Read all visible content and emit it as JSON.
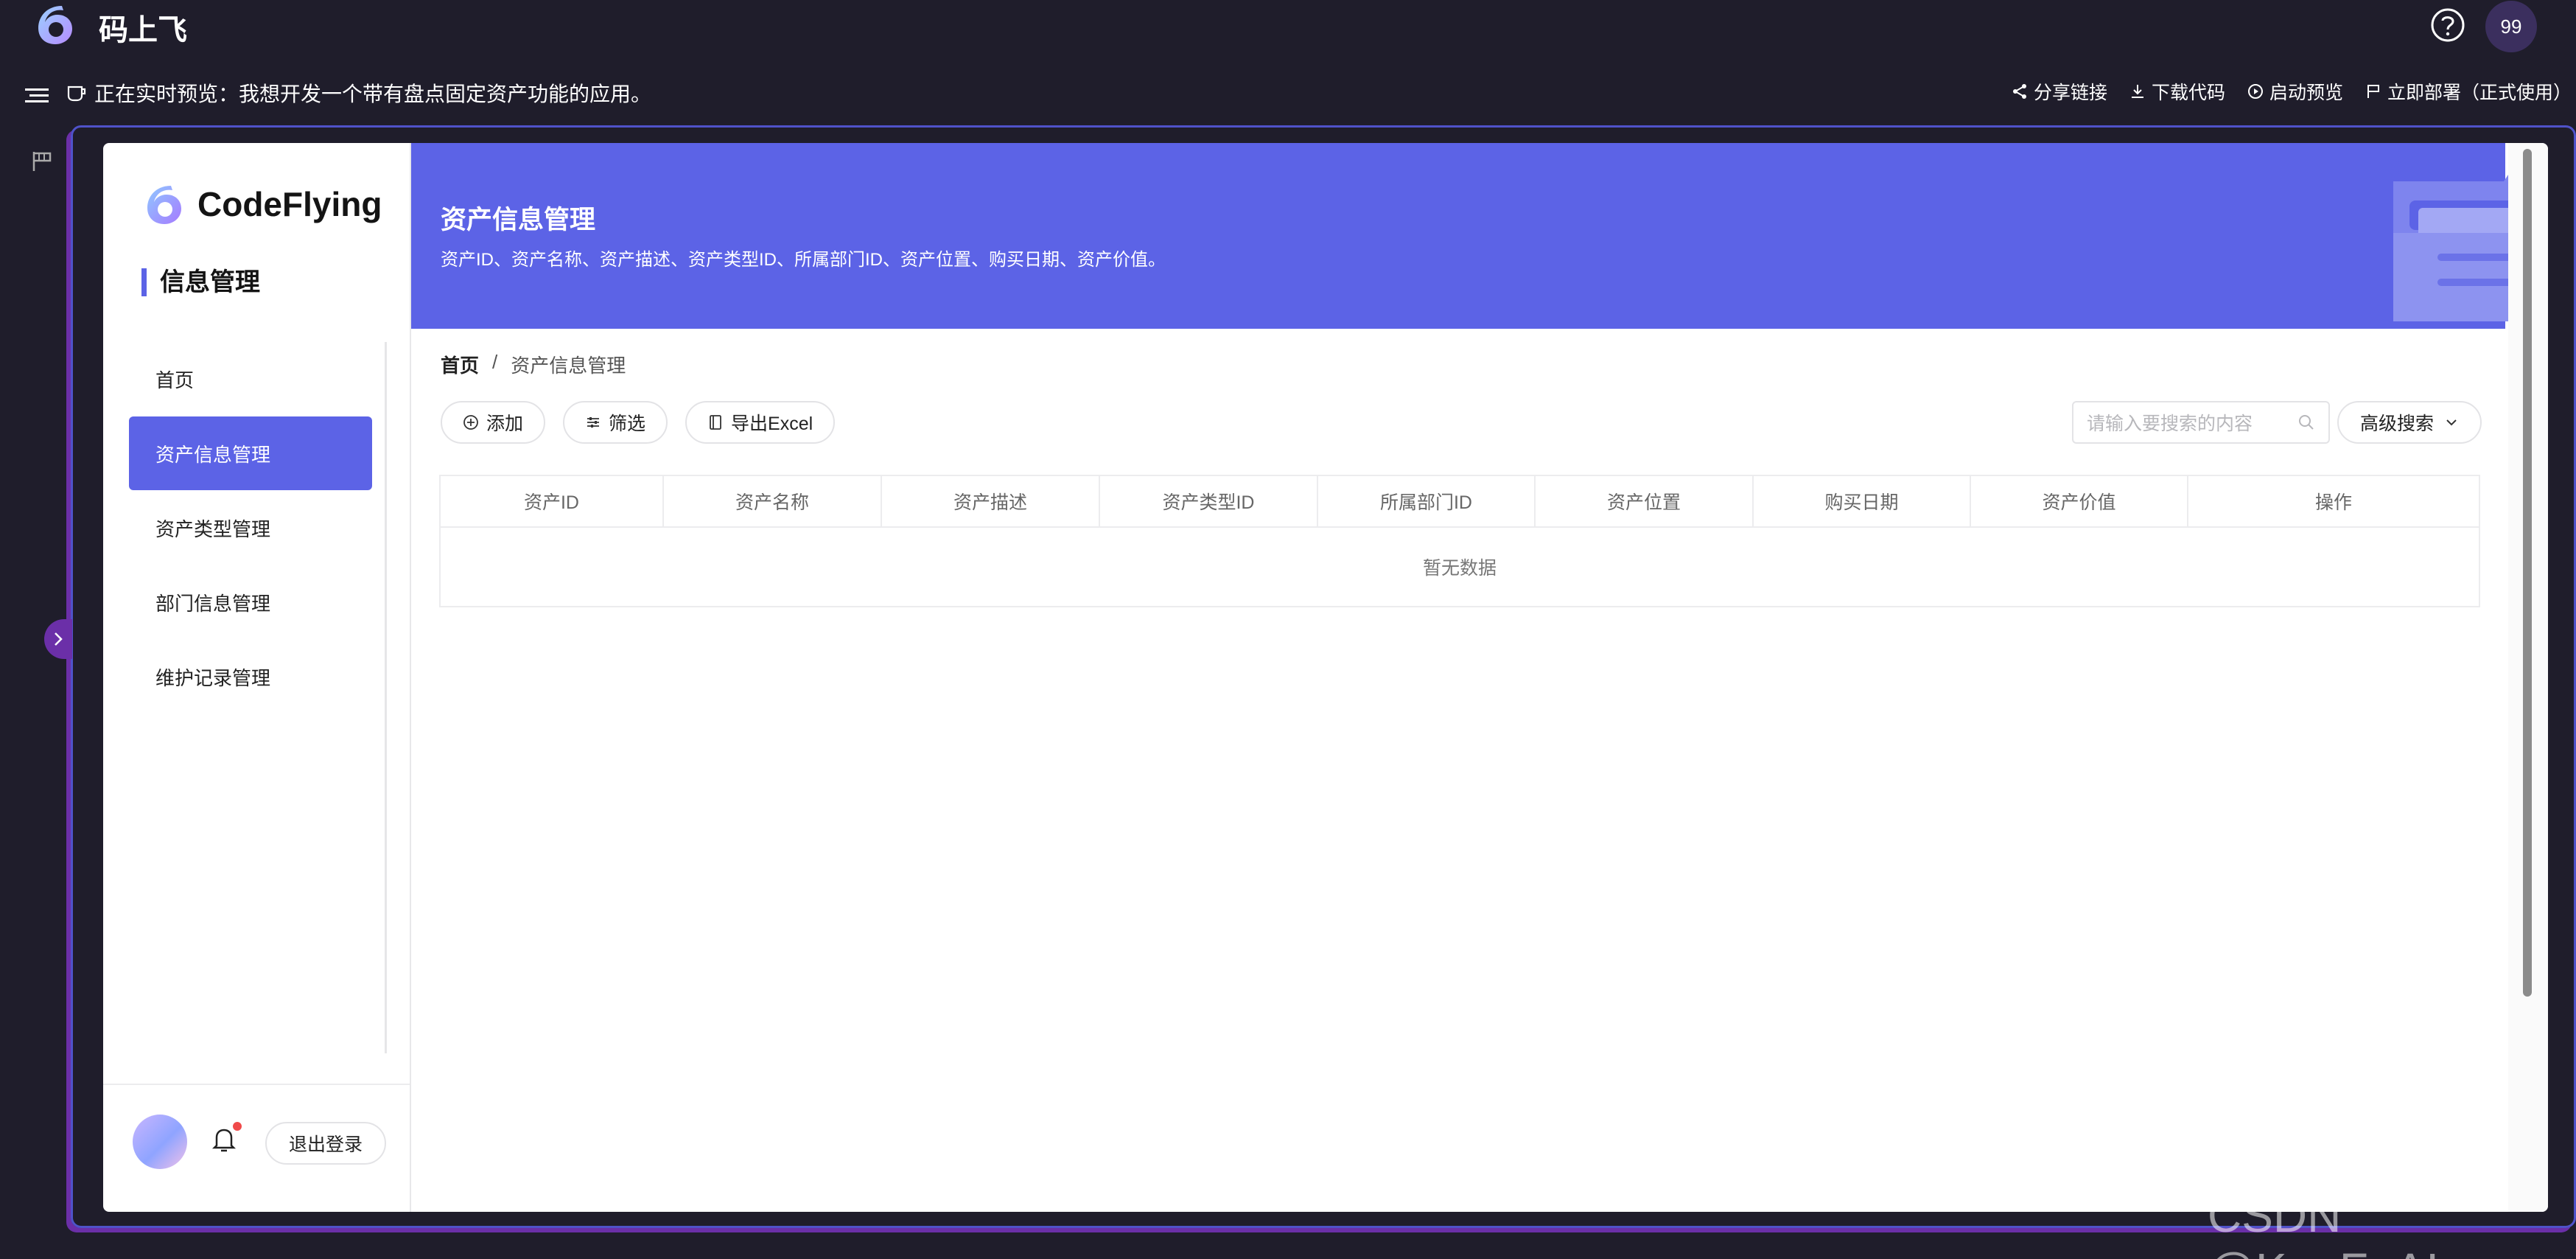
{
  "topbar": {
    "app_name": "码上飞",
    "badge": "99"
  },
  "preview": {
    "title": "正在实时预览：我想开发一个带有盘点固定资产功能的应用。",
    "actions": [
      "分享链接",
      "下载代码",
      "启动预览",
      "立即部署（正式使用）"
    ]
  },
  "sidebar": {
    "brand": "CodeFlying",
    "section": "信息管理",
    "items": [
      {
        "label": "首页",
        "active": false
      },
      {
        "label": "资产信息管理",
        "active": true
      },
      {
        "label": "资产类型管理",
        "active": false
      },
      {
        "label": "部门信息管理",
        "active": false
      },
      {
        "label": "维护记录管理",
        "active": false
      }
    ],
    "logout": "退出登录"
  },
  "banner": {
    "title": "资产信息管理",
    "desc": "资产ID、资产名称、资产描述、资产类型ID、所属部门ID、资产位置、购买日期、资产价值。"
  },
  "breadcrumb": {
    "home": "首页",
    "separator": "/",
    "current": "资产信息管理"
  },
  "toolbar": {
    "add": "添加",
    "filter": "筛选",
    "export": "导出Excel"
  },
  "search": {
    "placeholder": "请输入要搜索的内容",
    "advanced": "高级搜索"
  },
  "table": {
    "columns": [
      "资产ID",
      "资产名称",
      "资产描述",
      "资产类型ID",
      "所属部门ID",
      "资产位置",
      "购买日期",
      "资产价值",
      "操作"
    ],
    "empty_text": "暂无数据"
  },
  "watermark": "CSDN @KuaFuAI",
  "colors": {
    "accent": "#5c63e6",
    "background": "#1f1d2b",
    "frame_border": "#4f52c9"
  }
}
